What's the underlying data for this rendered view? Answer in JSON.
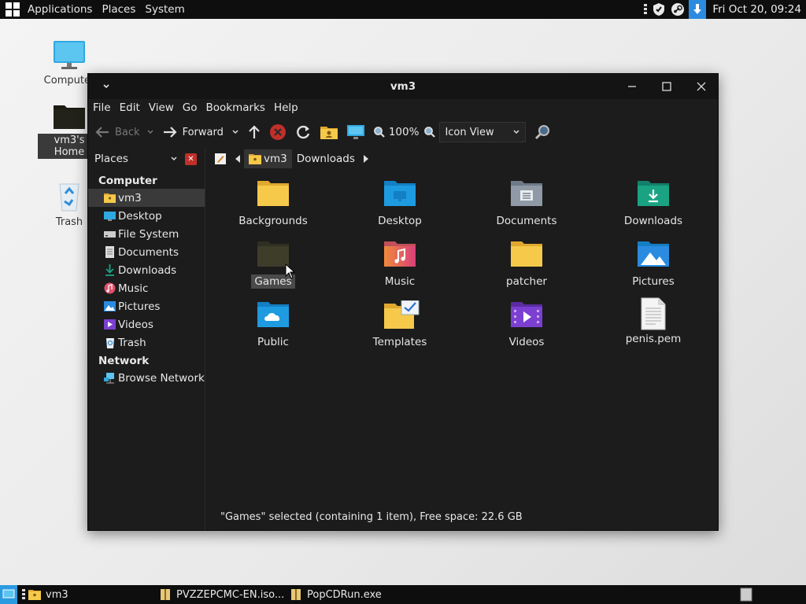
{
  "top_panel": {
    "menus": [
      "Applications",
      "Places",
      "System"
    ],
    "clock": "Fri Oct 20, 09:24"
  },
  "desktop": {
    "icons": [
      {
        "label": "Computer"
      },
      {
        "label": "vm3's Home"
      },
      {
        "label": "Trash"
      }
    ]
  },
  "window": {
    "title": "vm3",
    "menu": [
      "File",
      "Edit",
      "View",
      "Go",
      "Bookmarks",
      "Help"
    ],
    "toolbar": {
      "back": "Back",
      "forward": "Forward",
      "zoom": "100%",
      "view_mode": "Icon View"
    },
    "sidebar": {
      "header": "Places",
      "groups": [
        {
          "label": "Computer",
          "items": [
            {
              "label": "vm3",
              "icon": "home-folder-icon"
            },
            {
              "label": "Desktop",
              "icon": "desktop-icon"
            },
            {
              "label": "File System",
              "icon": "drive-icon"
            },
            {
              "label": "Documents",
              "icon": "documents-icon"
            },
            {
              "label": "Downloads",
              "icon": "download-icon"
            },
            {
              "label": "Music",
              "icon": "music-icon"
            },
            {
              "label": "Pictures",
              "icon": "pictures-icon"
            },
            {
              "label": "Videos",
              "icon": "videos-icon"
            },
            {
              "label": "Trash",
              "icon": "trash-icon"
            }
          ]
        },
        {
          "label": "Network",
          "items": [
            {
              "label": "Browse Network",
              "icon": "network-icon"
            }
          ]
        }
      ]
    },
    "path": {
      "crumbs": [
        "vm3",
        "Downloads"
      ]
    },
    "files": [
      {
        "name": "Backgrounds",
        "icon": "folder-icon"
      },
      {
        "name": "Desktop",
        "icon": "folder-desktop-icon"
      },
      {
        "name": "Documents",
        "icon": "folder-documents-icon"
      },
      {
        "name": "Downloads",
        "icon": "folder-downloads-icon"
      },
      {
        "name": "Games",
        "icon": "folder-icon"
      },
      {
        "name": "Music",
        "icon": "folder-music-icon"
      },
      {
        "name": "patcher",
        "icon": "folder-icon"
      },
      {
        "name": "Pictures",
        "icon": "folder-pictures-icon"
      },
      {
        "name": "Public",
        "icon": "folder-public-icon"
      },
      {
        "name": "Templates",
        "icon": "folder-templates-icon"
      },
      {
        "name": "Videos",
        "icon": "folder-videos-icon"
      },
      {
        "name": "penis.pem",
        "icon": "text-file-icon"
      }
    ],
    "status": "\"Games\" selected (containing 1 item), Free space: 22.6 GB"
  },
  "taskbar": {
    "tasks": [
      "vm3",
      "PVZZEPCMC-EN.iso...",
      "PopCDRun.exe"
    ]
  },
  "colors": {
    "folder_yellow": "#f6c94a",
    "folder_blue": "#1e9be0",
    "folder_teal": "#1aa383",
    "folder_gray": "#8f9aa6",
    "folder_purple": "#7b3fd1",
    "accent_red": "#c0302a"
  }
}
